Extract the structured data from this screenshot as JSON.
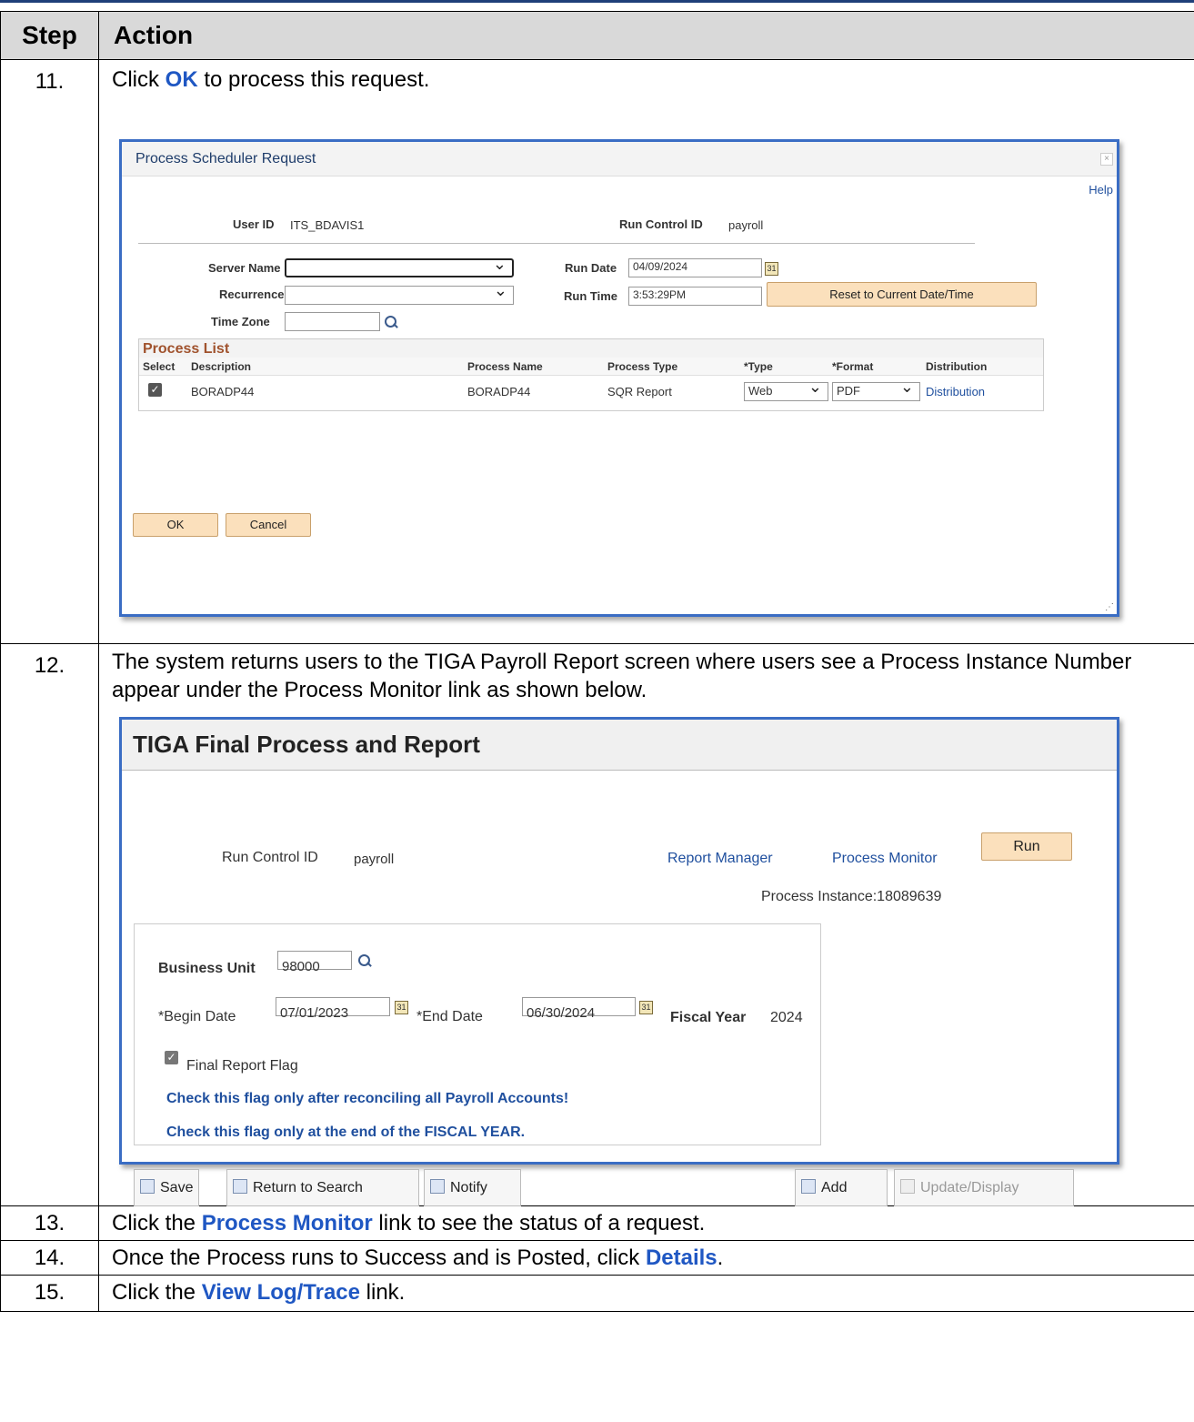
{
  "header": {
    "step": "Step",
    "action": "Action"
  },
  "rows": [
    {
      "num": "11.",
      "text_before": "Click ",
      "link": "OK",
      "text_after": " to process this request."
    },
    {
      "num": "12.",
      "text": "The system returns users to the TIGA Payroll Report screen where users see a Process Instance Number appear under the Process Monitor link as shown below."
    },
    {
      "num": "13.",
      "text_before": "Click the ",
      "link": "Process Monitor",
      "text_after": " link to see the status of a request."
    },
    {
      "num": "14.",
      "text_before": "Once the Process runs to Success and is Posted, click ",
      "link": "Details",
      "text_after": "."
    },
    {
      "num": "15.",
      "text_before": "Click the ",
      "link": "View Log/Trace",
      "text_after": " link."
    }
  ],
  "dialog1": {
    "title": "Process Scheduler Request",
    "close": "×",
    "help": "Help",
    "user_id_label": "User ID",
    "user_id": "ITS_BDAVIS1",
    "run_control_label": "Run Control ID",
    "run_control": "payroll",
    "server_name_label": "Server Name",
    "recurrence_label": "Recurrence",
    "time_zone_label": "Time Zone",
    "run_date_label": "Run Date",
    "run_date": "04/09/2024",
    "run_time_label": "Run Time",
    "run_time": "3:53:29PM",
    "reset_button": "Reset to Current Date/Time",
    "process_list": {
      "title": "Process List",
      "columns": [
        "Select",
        "Description",
        "Process Name",
        "Process Type",
        "*Type",
        "*Format",
        "Distribution"
      ],
      "row": {
        "description": "BORADP44",
        "process_name": "BORADP44",
        "process_type": "SQR Report",
        "type": "Web",
        "format": "PDF",
        "distribution": "Distribution"
      }
    },
    "ok_button": "OK",
    "cancel_button": "Cancel"
  },
  "dialog2": {
    "title": "TIGA Final Process and Report",
    "run_control_label": "Run Control ID",
    "run_control": "payroll",
    "report_manager": "Report Manager",
    "process_monitor": "Process Monitor",
    "run_button": "Run",
    "process_instance": "Process Instance:18089639",
    "business_unit_label": "Business Unit",
    "business_unit": "98000",
    "begin_date_label": "*Begin Date",
    "begin_date": "07/01/2023",
    "end_date_label": "*End Date",
    "end_date": "06/30/2024",
    "fiscal_year_label": "Fiscal Year",
    "fiscal_year": "2024",
    "final_flag_label": "Final Report Flag",
    "note1": "Check this flag only after reconciling all Payroll Accounts!",
    "note2": "Check this flag only at the end of the FISCAL YEAR.",
    "toolbar": {
      "save": "Save",
      "return": "Return to Search",
      "notify": "Notify",
      "add": "Add",
      "update": "Update/Display"
    }
  },
  "colors": {
    "link": "#1f57c3",
    "dialog_border": "#3a6dc4",
    "header_bg": "#d9d9d9",
    "button_bg": "#fbe0bc"
  }
}
